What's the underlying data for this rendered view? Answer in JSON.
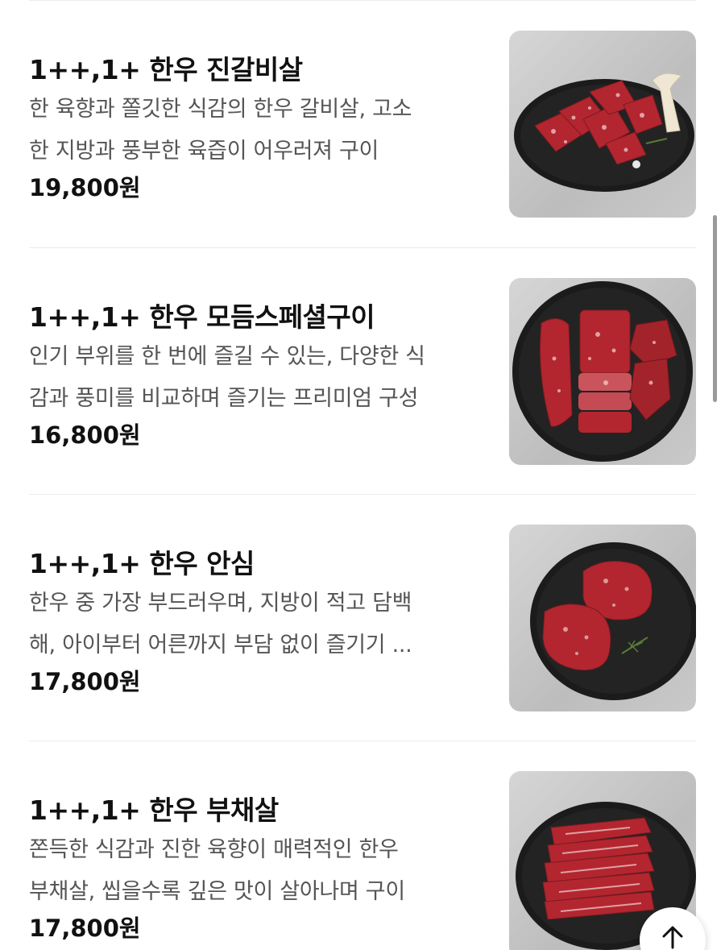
{
  "products": [
    {
      "name": "1++,1+ 한우 진갈비살",
      "desc_lines": [
        "한 육향과 쫄깃한 식감의 한우 갈비살, 고소",
        "한 지방과 풍부한 육즙이 어우러져 구이"
      ],
      "price": "19,800원",
      "image_icon": "galbisal-photo"
    },
    {
      "name": "1++,1+ 한우 모듬스페셜구이",
      "desc_lines": [
        "인기 부위를 한 번에 즐길 수 있는, 다양한 식",
        "감과 풍미를 비교하며 즐기는 프리미엄 구성"
      ],
      "price": "16,800원",
      "image_icon": "assorted-special-photo"
    },
    {
      "name": "1++,1+ 한우 안심",
      "desc_lines": [
        "한우 중 가장 부드러우며, 지방이 적고 담백",
        "해, 아이부터 어른까지 부담 없이 즐기기 ..."
      ],
      "price": "17,800원",
      "image_icon": "tenderloin-photo"
    },
    {
      "name": "1++,1+ 한우 부채살",
      "desc_lines": [
        "쫀득한 식감과 진한 육향이 매력적인 한우",
        "부채살, 씹을수록 깊은 맛이 살아나며 구이"
      ],
      "price": "17,800원",
      "image_icon": "top-blade-photo"
    }
  ],
  "scroll_top_icon": "arrow-up-icon",
  "colors": {
    "title": "#111111",
    "description": "#555555",
    "divider": "#ececec",
    "plate": "#1b1b1b",
    "meat": "#b3262f",
    "marbling": "#f1d6d6"
  }
}
